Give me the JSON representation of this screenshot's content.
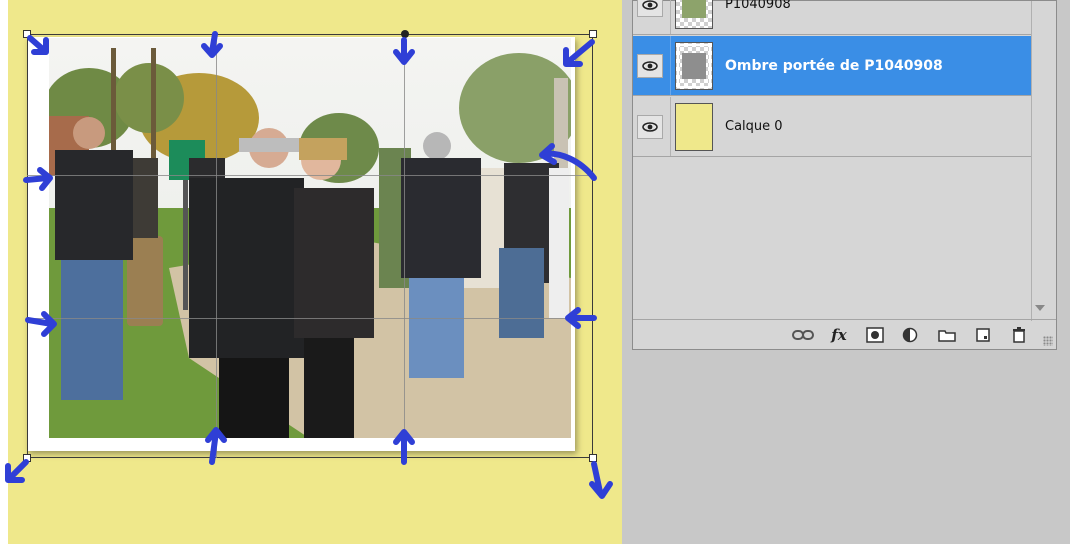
{
  "layers_panel": {
    "layers": [
      {
        "name": "P1040908",
        "visible": true,
        "selected": false,
        "thumbnail": "photo-thumbnail"
      },
      {
        "name": "Ombre portée de P1040908",
        "visible": true,
        "selected": true,
        "thumbnail": "shadow-thumbnail"
      },
      {
        "name": "Calque 0",
        "visible": true,
        "selected": false,
        "thumbnail": "yellow-fill-thumbnail"
      }
    ],
    "footer_buttons": [
      {
        "name": "link-layers-icon"
      },
      {
        "name": "layer-style-fx-icon",
        "label": "fx"
      },
      {
        "name": "add-mask-icon"
      },
      {
        "name": "adjustment-layer-icon"
      },
      {
        "name": "new-group-icon"
      },
      {
        "name": "new-layer-icon"
      },
      {
        "name": "delete-layer-icon"
      }
    ]
  },
  "colors": {
    "canvas_background": "#efe88b",
    "selection_highlight": "#3a8ee6",
    "annotation_arrows": "#2f3fd6",
    "app_background": "#c8c8c8",
    "panel_background": "#d6d6d6"
  }
}
